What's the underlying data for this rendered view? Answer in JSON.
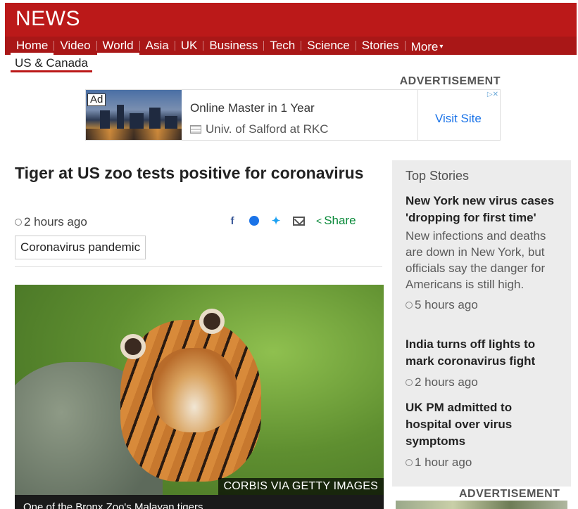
{
  "header": {
    "logo": "NEWS",
    "nav": [
      {
        "label": "Home",
        "active": true
      },
      {
        "label": "Video",
        "active": false
      },
      {
        "label": "World",
        "active": true
      },
      {
        "label": "Asia",
        "active": false
      },
      {
        "label": "UK",
        "active": false
      },
      {
        "label": "Business",
        "active": false
      },
      {
        "label": "Tech",
        "active": false
      },
      {
        "label": "Science",
        "active": false
      },
      {
        "label": "Stories",
        "active": false
      }
    ],
    "more_label": "More",
    "subnav": "US & Canada",
    "brand_color": "#bb1919"
  },
  "ad_top": {
    "label": "ADVERTISEMENT",
    "badge": "Ad",
    "title": "Online Master in 1 Year",
    "source": "Univ. of Salford at RKC",
    "cta": "Visit Site"
  },
  "article": {
    "headline": "Tiger at US zoo tests positive for coronavirus",
    "time": "2 hours ago",
    "share_label": "Share",
    "tag": "Coronavirus pandemic",
    "image_credit": "CORBIS VIA GETTY IMAGES",
    "caption": "One of the Bronx Zoo's Malayan tigers"
  },
  "top_stories": {
    "heading": "Top Stories",
    "items": [
      {
        "title": "New York new virus cases 'dropping for first time'",
        "summary": "New infections and deaths are down in New York, but officials say the danger for Americans is still high.",
        "time": "5 hours ago"
      },
      {
        "title": "India turns off lights to mark coronavirus fight",
        "summary": "",
        "time": "2 hours ago"
      },
      {
        "title": "UK PM admitted to hospital over virus symptoms",
        "summary": "",
        "time": "1 hour ago"
      }
    ]
  },
  "ad_side": {
    "label": "ADVERTISEMENT"
  }
}
